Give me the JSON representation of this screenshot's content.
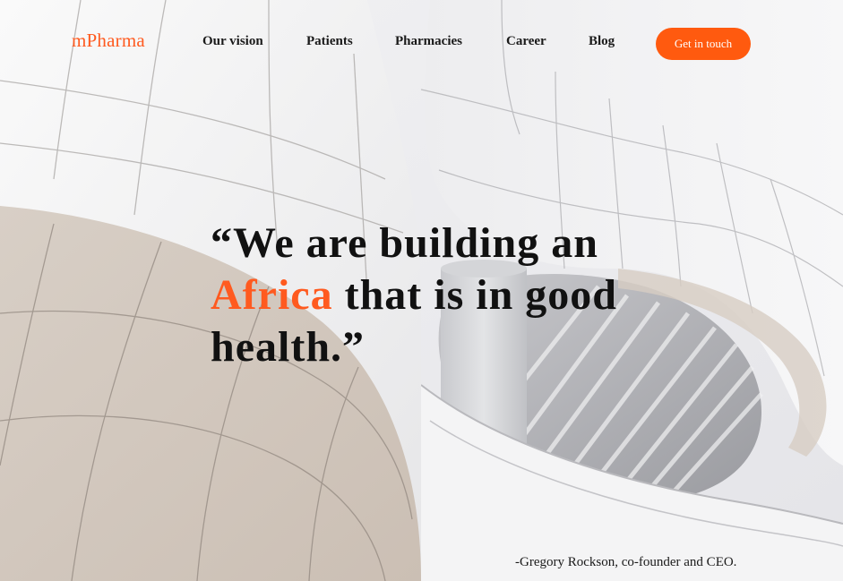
{
  "brand": {
    "logo": "mPharma",
    "accent_color": "#ff5a1f"
  },
  "nav": {
    "links": [
      "Our vision",
      "Patients",
      "Pharmacies",
      "Career",
      "Blog"
    ],
    "cta_label": "Get in touch"
  },
  "hero": {
    "background": "architectural-photo",
    "quote": {
      "open_quote": "“",
      "line1": "We are building an",
      "accent_word": "Africa",
      "line2_rest": " that is in good",
      "line3": "health.",
      "close_quote": "”"
    },
    "attribution": "-Gregory Rockson, co-founder and CEO."
  }
}
